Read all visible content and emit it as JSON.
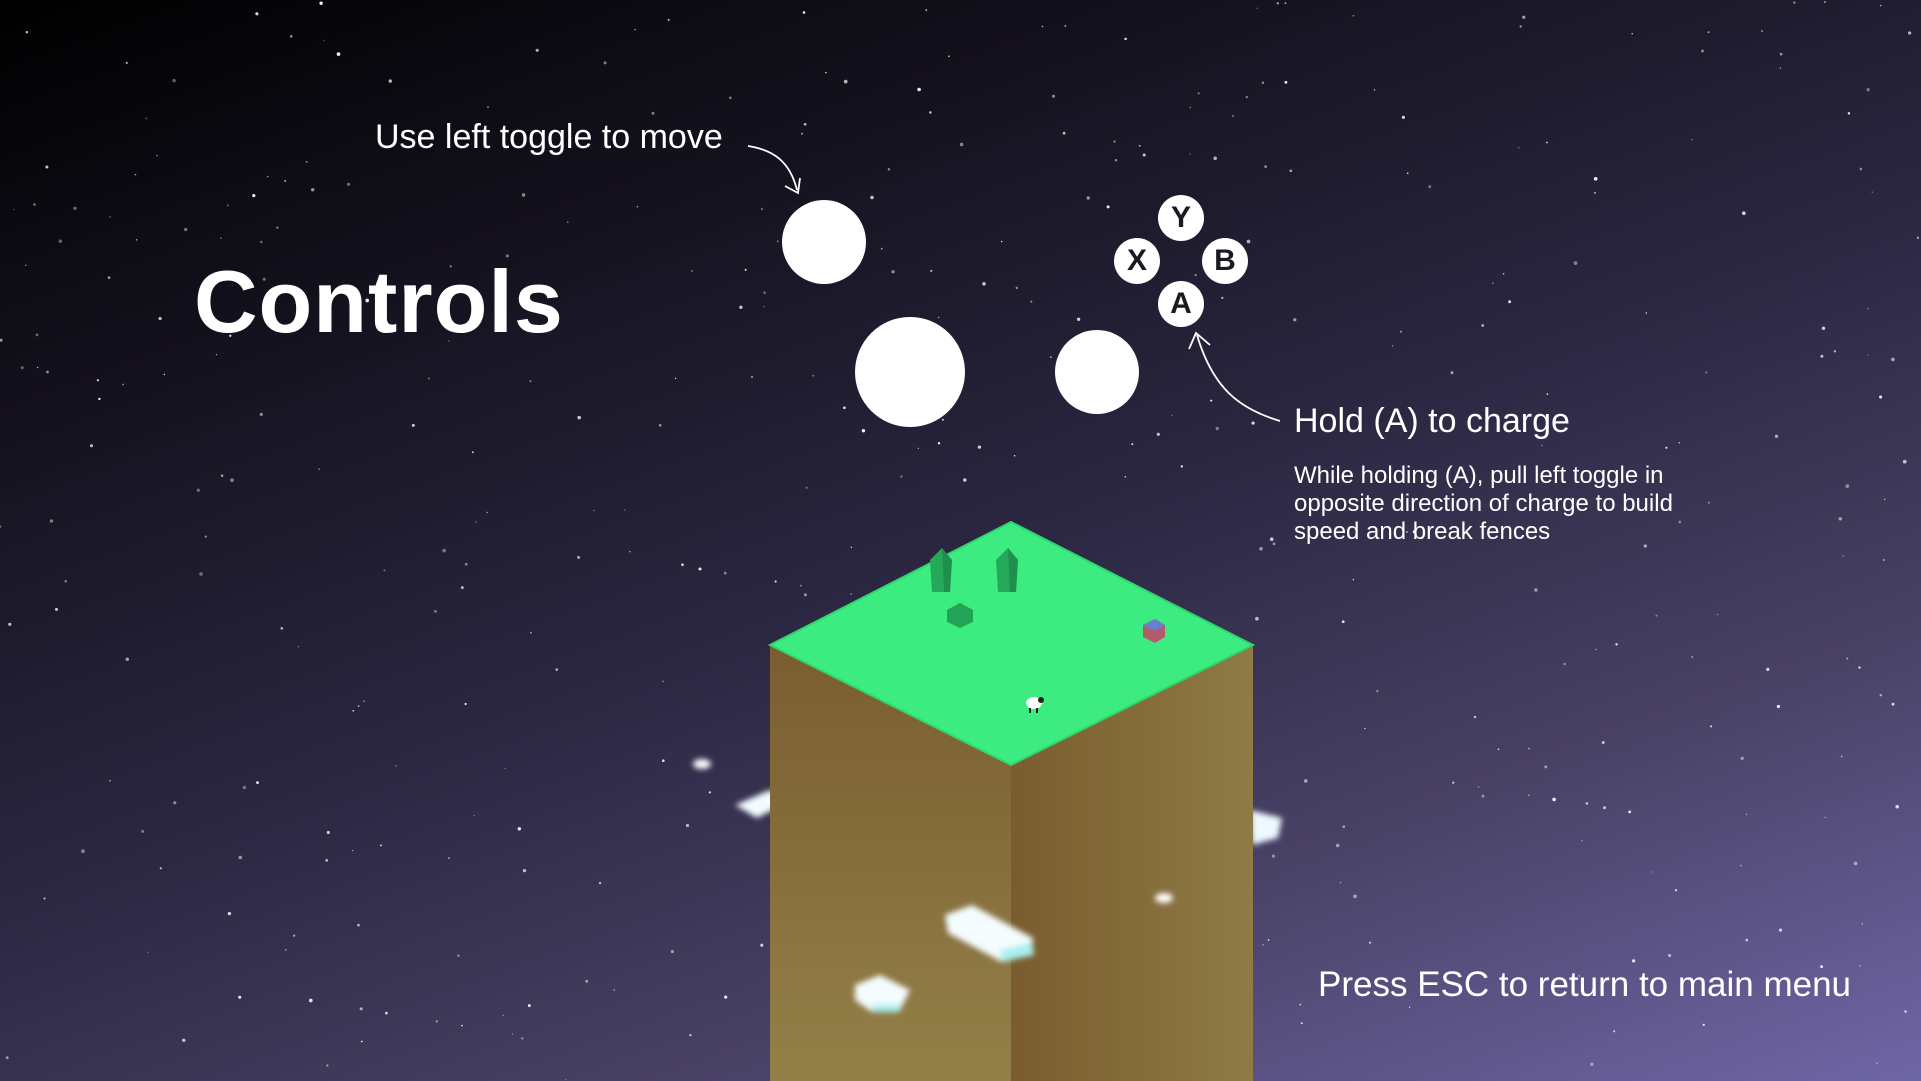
{
  "screen": {
    "title": "Controls",
    "hint_move": "Use left toggle to move",
    "hint_charge": "Hold (A) to charge",
    "hint_charge_detail": "While holding (A), pull left toggle in opposite direction of charge to build speed and break fences",
    "hint_escape": "Press ESC to return to main menu"
  },
  "buttons": {
    "y": "Y",
    "x": "X",
    "b": "B",
    "a": "A"
  },
  "colors": {
    "grass_top": "#3cec80",
    "dirt_left": "#7c6235",
    "dirt_right": "#8a7442",
    "tree": "#26a85a",
    "cloud": "#f2fbff"
  },
  "icons": {
    "left_stick": "left-toggle-icon",
    "right_stick": "right-toggle-icon",
    "dpad": "dpad-icon"
  }
}
